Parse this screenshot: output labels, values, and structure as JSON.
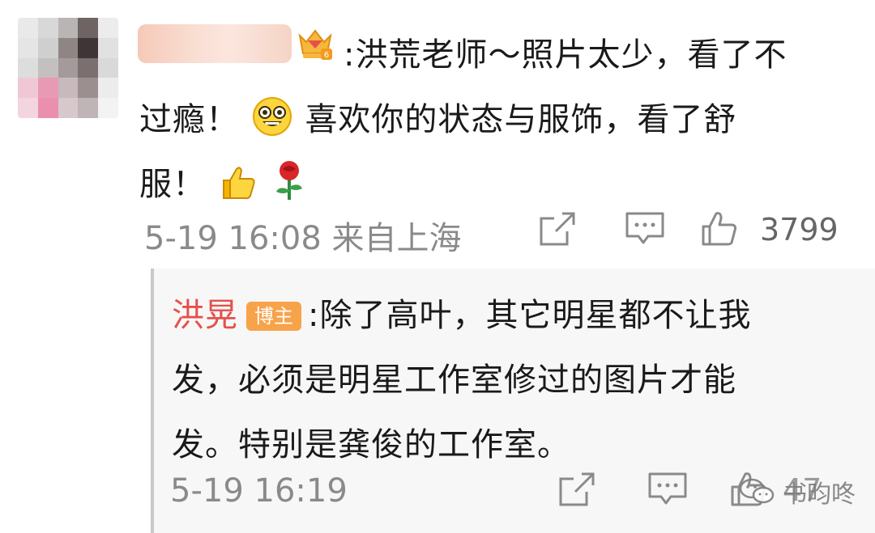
{
  "comment": {
    "username": "",
    "text_parts": [
      ":洪荒老师～照片太少，看了不",
      "过瘾！",
      "喜欢你的状态与服饰，看了舒",
      "服！"
    ],
    "timestamp": "5-19 16:08",
    "location": "来自上海",
    "like_count": "3799",
    "icons": [
      "share-icon",
      "comment-icon",
      "like-icon",
      "crown-badge-icon",
      "grinning-emoji-icon",
      "thumbs-up-emoji-icon",
      "rose-emoji-icon"
    ]
  },
  "reply": {
    "username": "洪晃",
    "badge": "博主",
    "text_parts": [
      ":除了高叶，其它明星都不让我",
      "发，必须是明星工作室修过的图片才能",
      "发。特别是龚俊的工作室。"
    ],
    "timestamp": "5-19 16:19",
    "like_count": "47"
  },
  "watermark": {
    "text": "书昀咚"
  },
  "colors": {
    "username_red": "#e6504b",
    "badge_orange": "#f7a34a",
    "meta_gray": "#8a8a8a",
    "reply_bg": "#f7f7f7"
  }
}
